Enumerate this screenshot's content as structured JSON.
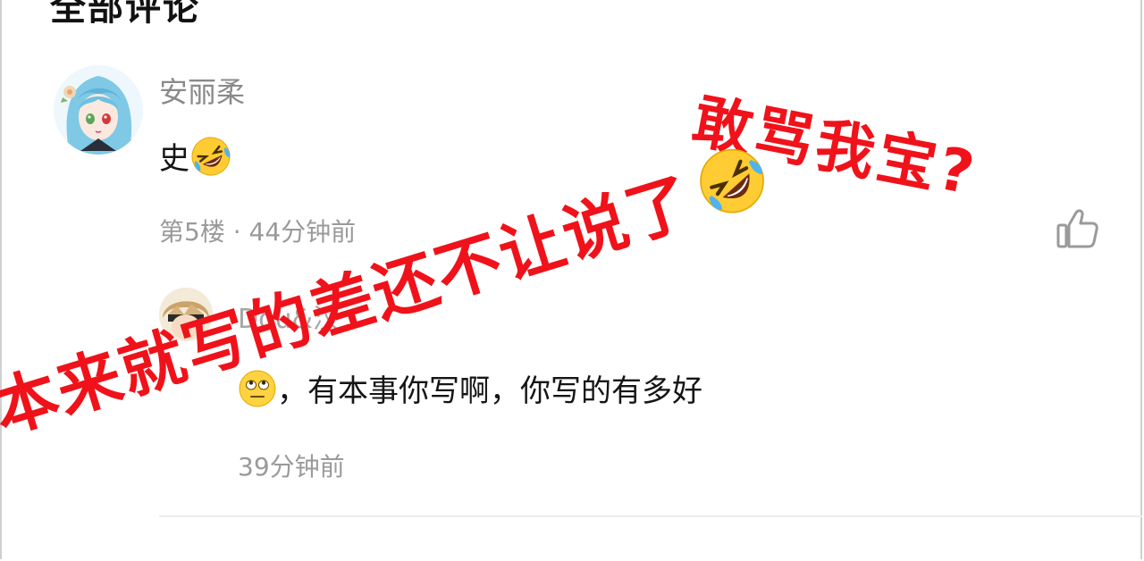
{
  "section": {
    "title": "全部评论"
  },
  "comments": [
    {
      "username": "安丽柔",
      "text": "史",
      "emoji": "rofl-emoji",
      "floor": "第5楼",
      "separator": "·",
      "time": "44分钟前",
      "avatar": "anime-girl-avatar"
    },
    {
      "username": "Dou&汉",
      "text": "，有本事你写啊，你写的有多好",
      "emoji": "eye-roll-emoji",
      "time": "39分钟前",
      "avatar": "anime-boy-avatar"
    }
  ],
  "overlays": {
    "caption_1": "敢骂我宝?",
    "caption_2": "本来就写的差还不让说了",
    "caption_2_emoji": "rofl-emoji"
  },
  "icons": {
    "like": "thumbs-up-icon"
  },
  "colors": {
    "caption": "#f0121a",
    "meta": "#9a9a9a",
    "username": "#8a8a8a"
  }
}
